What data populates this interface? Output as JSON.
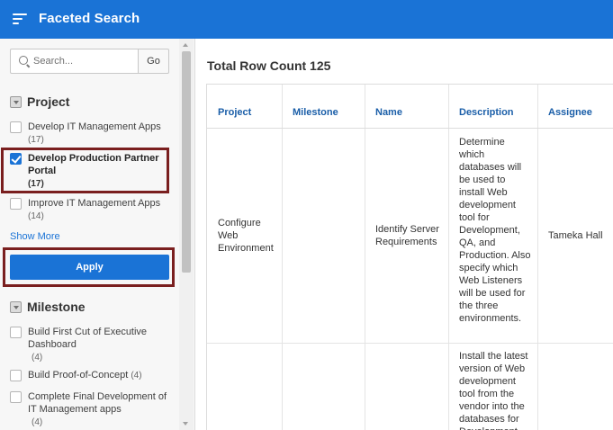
{
  "header": {
    "title": "Faceted Search",
    "menu_icon": "hamburger-menu-icon",
    "bg_color": "#1a73d6"
  },
  "search": {
    "placeholder": "Search...",
    "value": "",
    "go_label": "Go",
    "icon": "search-icon"
  },
  "facets": {
    "project": {
      "title": "Project",
      "items": [
        {
          "label": "Develop IT Management Apps",
          "count": "(17)",
          "checked": false
        },
        {
          "label": "Develop Production Partner Portal",
          "count": "(17)",
          "checked": true
        },
        {
          "label": "Improve IT Management Apps",
          "count": "(14)",
          "checked": false
        }
      ],
      "show_more": "Show More"
    },
    "apply_label": "Apply",
    "milestone": {
      "title": "Milestone",
      "items": [
        {
          "label": "Build First Cut of Executive Dashboard",
          "count": "(4)",
          "checked": false
        },
        {
          "label": "Build Proof-of-Concept",
          "count": "(4)",
          "checked": false
        },
        {
          "label": "Complete Final Development of IT Management apps",
          "count": "(4)",
          "checked": false
        }
      ]
    }
  },
  "report": {
    "row_count_label": "Total Row Count 125",
    "columns": [
      "Project",
      "Milestone",
      "Name",
      "Description",
      "Assignee"
    ],
    "rows": [
      {
        "project": "Configure Web Environment",
        "milestone": "",
        "name": "Identify Server Requirements",
        "description": "Determine which databases will be used to install Web development tool for Development, QA, and Production. Also specify which Web Listeners will be used for the three environments.",
        "assignee": "Tameka Hall"
      },
      {
        "project": "",
        "milestone": "",
        "name": "",
        "description": "Install the latest version of Web development tool from the vendor into the databases for Development",
        "assignee": ""
      }
    ]
  },
  "colors": {
    "accent": "#1a73d6",
    "highlight": "#7a1f1f"
  }
}
